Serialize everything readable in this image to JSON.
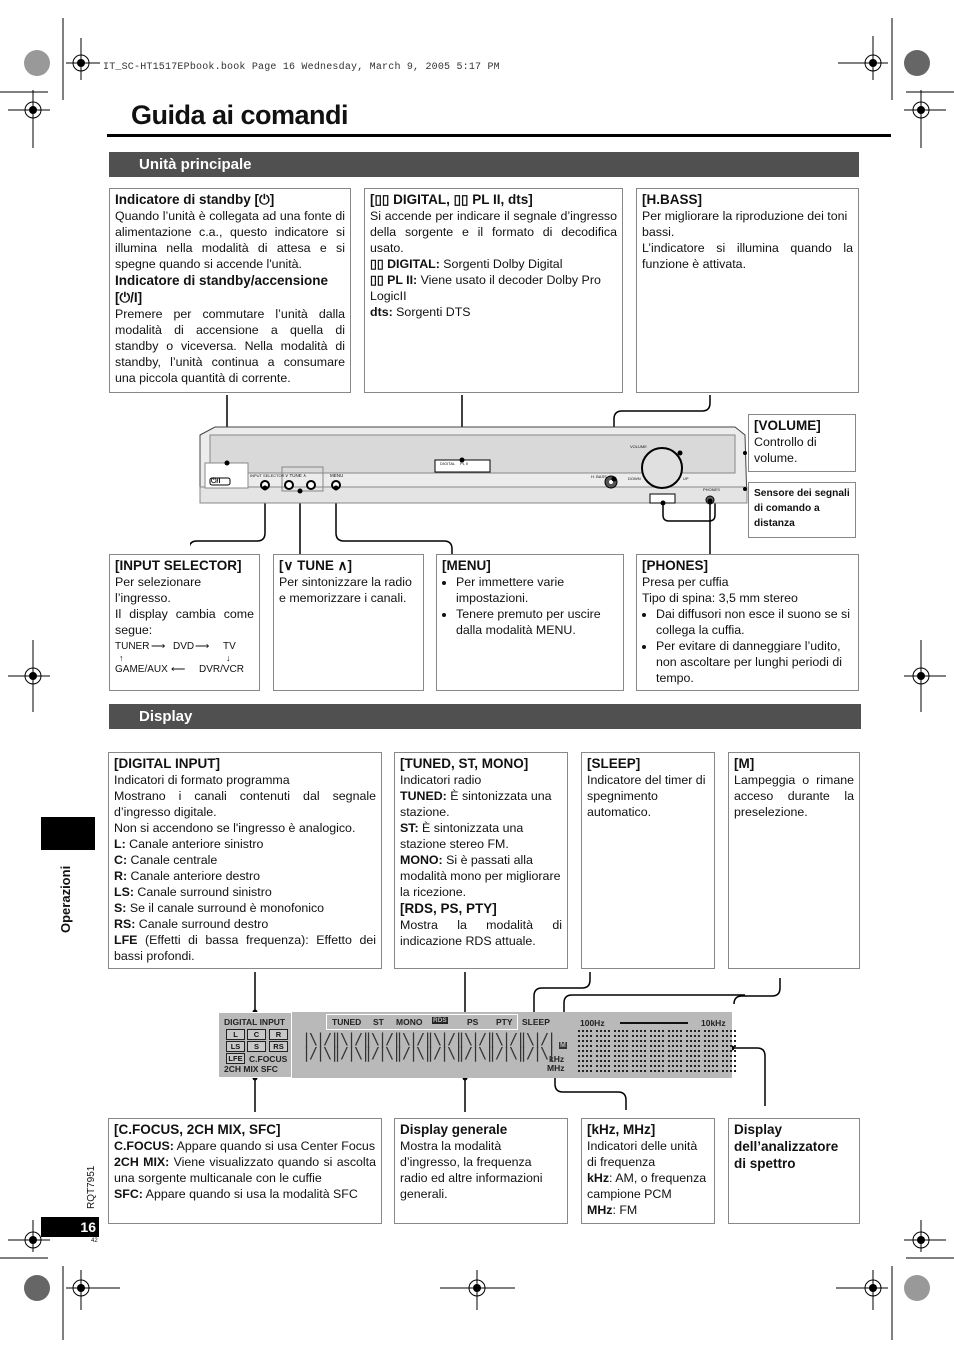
{
  "header": {
    "file_info": "IT_SC-HT1517EPbook.book  Page 16  Wednesday, March 9, 2005  5:17 PM"
  },
  "title": "Guida ai comandi",
  "sections": {
    "main_unit": "Unità principale",
    "display": "Display"
  },
  "main_unit": {
    "standby": {
      "heading": "Indicatore di standby [⏻]",
      "text": "Quando l’unità è collegata ad una fonte di alimentazione c.a., questo indicatore si illumina nella modalità di attesa e si spegne quando si accende l'unità.",
      "heading2": "Indicatore di standby/accensione [⏻/I]",
      "text2": "Premere per commutare l’unità dalla modalità di accensione a quella di standby o viceversa. Nella modalità di standby, l’unità continua a consumare una piccola quantità di corrente."
    },
    "digital": {
      "heading": "[▯▯ DIGITAL, ▯▯ PL II, dts]",
      "text": "Si accende per indicare il segnale d’ingresso della sorgente e il formato di decodifica usato.",
      "dd_label": "▯▯ DIGITAL:",
      "dd_text": "Sorgenti Dolby Digital",
      "pl_label": "▯▯ PL II:",
      "pl_text": "Viene usato il decoder Dolby Pro LogicII",
      "dts_label": "dts:",
      "dts_text": "Sorgenti DTS"
    },
    "hbass": {
      "heading": "[H.BASS]",
      "text1": "Per migliorare la riproduzione dei toni bassi.",
      "text2": "L’indicatore si illumina quando la funzione è attivata."
    },
    "volume": {
      "heading": "[VOLUME]",
      "text": "Controllo di volume."
    },
    "sensor": {
      "text": "Sensore dei segnali di comando a distanza"
    },
    "input_selector": {
      "heading": "[INPUT SELECTOR]",
      "text1": "Per selezionare l’ingresso.",
      "text2": "Il display cambia come segue:",
      "chain": [
        "TUNER",
        "DVD",
        "TV",
        "DVR/VCR",
        "GAME/AUX"
      ]
    },
    "tune": {
      "heading": "[∨ TUNE ∧]",
      "text": "Per sintonizzare la radio e memorizzare i canali."
    },
    "menu": {
      "heading": "[MENU]",
      "bullets": [
        "Per immettere varie impostazioni.",
        "Tenere premuto per uscire dalla modalità MENU."
      ]
    },
    "phones": {
      "heading": "[PHONES]",
      "text1": "Presa per cuffia",
      "text2": "Tipo di spina: 3,5 mm stereo",
      "bullets": [
        "Dai diffusori non esce il suono se si collega la cuffia.",
        "Per evitare di danneggiare l’udito, non ascoltare per lunghi periodi di tempo."
      ]
    },
    "device_labels": {
      "power_btn": "⏻/I",
      "input_selector": "INPUT SELECTOR",
      "tune": "∨ TUNE ∧",
      "menu": "MENU",
      "digital_ind": "DIGITAL",
      "pl_ind": "PL II",
      "dts_ind": "dts",
      "hbass": "H. BASS",
      "volume": "VOLUME",
      "down": "DOWN",
      "up": "UP",
      "phones": "PHONES"
    }
  },
  "display": {
    "digital_input": {
      "heading": "[DIGITAL INPUT]",
      "lines": [
        {
          "t": "Indicatori di formato programma"
        },
        {
          "t": "Mostrano i canali contenuti dal segnale d’ingresso digitale."
        },
        {
          "t": "Non si accendono se l'ingresso è analogico."
        },
        {
          "b": "L:",
          "t": " Canale anteriore sinistro"
        },
        {
          "b": "C:",
          "t": " Canale centrale"
        },
        {
          "b": "R:",
          "t": " Canale anteriore destro"
        },
        {
          "b": "LS:",
          "t": " Canale surround sinistro"
        },
        {
          "b": "S:",
          "t": " Se il canale surround è monofonico"
        },
        {
          "b": "RS:",
          "t": " Canale surround destro"
        },
        {
          "b": "LFE",
          "t": " (Effetti di bassa frequenza): Effetto dei bassi profondi."
        }
      ]
    },
    "tuned": {
      "heading": "[TUNED, ST, MONO]",
      "intro": "Indicatori radio",
      "items": [
        {
          "b": "TUNED:",
          "t": " È sintonizzata una stazione."
        },
        {
          "b": "ST:",
          "t": " È sintonizzata una stazione stereo FM."
        },
        {
          "b": "MONO:",
          "t": " Si è passati alla modalità mono per migliorare la ricezione."
        }
      ],
      "heading2": "[RDS, PS, PTY]",
      "text2": "Mostra la modalità di indicazione RDS attuale."
    },
    "sleep": {
      "heading": "[SLEEP]",
      "text": "Indicatore del timer di spegnimento automatico."
    },
    "m": {
      "heading": "[M]",
      "text": "Lampeggia o rimane acceso durante la preselezione."
    },
    "cfocus": {
      "heading": "[C.FOCUS, 2CH MIX, SFC]",
      "items": [
        {
          "b": "C.FOCUS:",
          "t": " Appare quando si usa Center Focus"
        },
        {
          "b": "2CH MIX:",
          "t": " Viene visualizzato quando si ascolta una sorgente multicanale con le cuffie"
        },
        {
          "b": "SFC:",
          "t": " Appare quando si usa la modalità SFC"
        }
      ]
    },
    "general": {
      "heading": "Display generale",
      "text": "Mostra la modalità d’ingresso, la frequenza radio ed altre informazioni generali."
    },
    "khz": {
      "heading": "[kHz, MHz]",
      "text": "Indicatori delle unità di frequenza",
      "items": [
        {
          "b": "kHz",
          "t": ": AM, o frequenza campione PCM"
        },
        {
          "b": "MHz",
          "t": ": FM"
        }
      ]
    },
    "spectrum": {
      "heading": "Display dell’analizzatore di spettro"
    },
    "lcd": {
      "digital_input": "DIGITAL INPUT",
      "channels": [
        "L",
        "C",
        "R",
        "LS",
        "S",
        "RS",
        "LFE"
      ],
      "cfocus": "C.FOCUS",
      "mix": "2CH MIX  SFC",
      "top_labels": [
        "TUNED",
        "ST",
        "MONO",
        "RDS",
        "PS",
        "PTY"
      ],
      "sleep": "SLEEP",
      "m": "M",
      "khz": "kHz",
      "mhz": "MHz",
      "freq_low": "100Hz",
      "freq_high": "10kHz"
    }
  },
  "sidebar": {
    "label": "Operazioni",
    "doc_code": "RQT7951",
    "page_number": "16",
    "page_sub": "42"
  }
}
